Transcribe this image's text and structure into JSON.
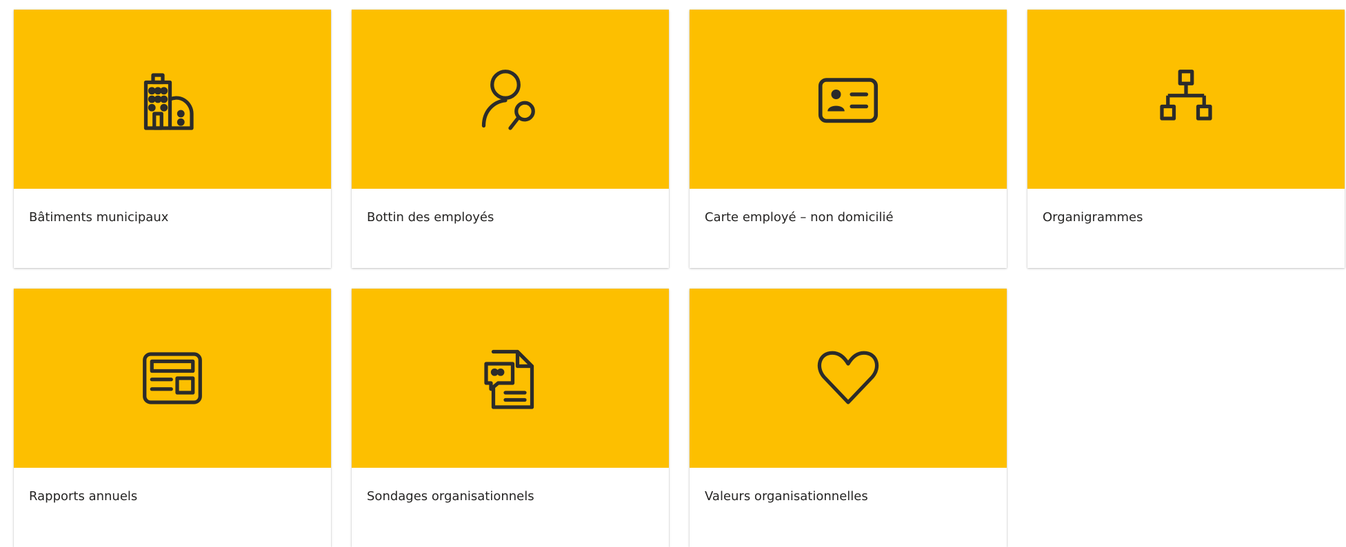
{
  "tiles": [
    {
      "label": "Bâtiments municipaux",
      "icon": "buildings-icon"
    },
    {
      "label": "Bottin des employés",
      "icon": "person-search-icon"
    },
    {
      "label": "Carte employé – non domicilié",
      "icon": "id-card-icon"
    },
    {
      "label": "Organigrammes",
      "icon": "org-chart-icon"
    },
    {
      "label": "Rapports annuels",
      "icon": "news-report-icon"
    },
    {
      "label": "Sondages organisationnels",
      "icon": "survey-document-icon"
    },
    {
      "label": "Valeurs organisationnelles",
      "icon": "heart-icon"
    }
  ],
  "colors": {
    "tile_background": "#fdbf00",
    "icon_stroke": "#2b2b2b",
    "label_text": "#252423"
  }
}
